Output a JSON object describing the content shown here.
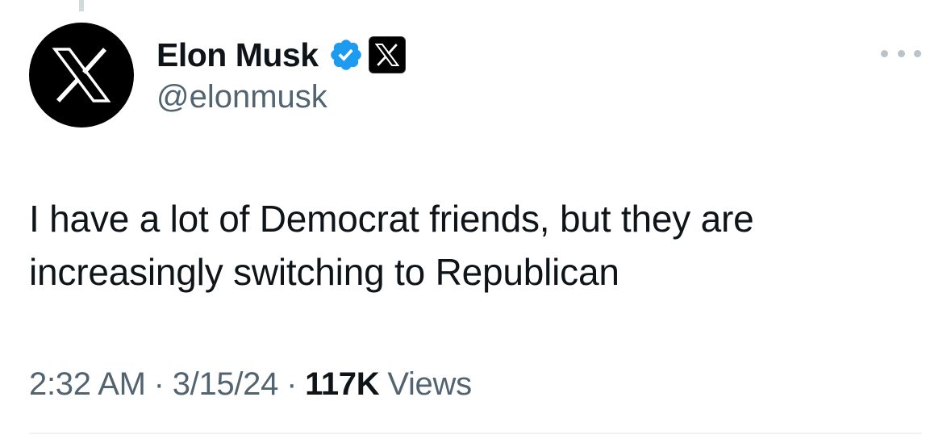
{
  "author": {
    "display_name": "Elon Musk",
    "handle": "@elonmusk",
    "avatar_icon": "x-logo-icon",
    "verified_icon": "verified-badge-icon",
    "affiliation_icon": "x-logo-icon"
  },
  "tweet": {
    "text_lines": [
      "I have a lot of Democrat friends, but they are",
      "increasingly switching to Republican"
    ]
  },
  "meta": {
    "time": "2:32 AM",
    "separator": "·",
    "date": "3/15/24",
    "views_count": "117K",
    "views_label": "Views"
  },
  "colors": {
    "verified_blue": "#1d9bf0",
    "text_primary": "#0f1419",
    "text_secondary": "#536471"
  }
}
